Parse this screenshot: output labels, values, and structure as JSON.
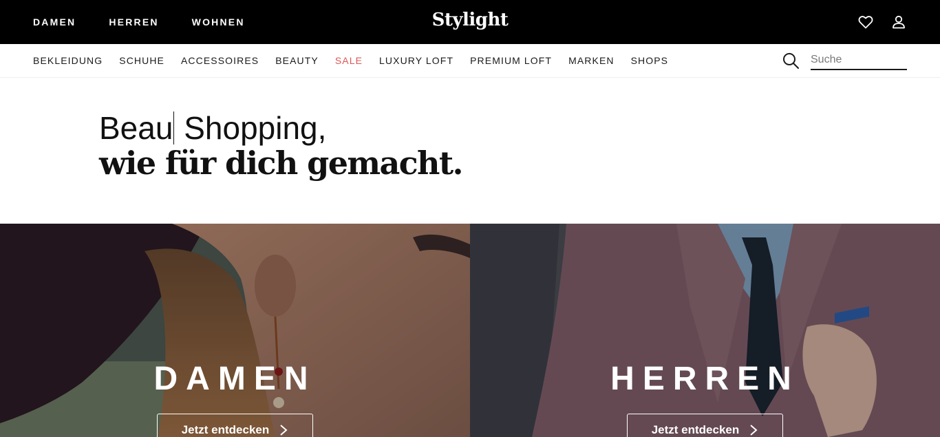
{
  "topbar": {
    "nav": [
      "DAMEN",
      "HERREN",
      "WOHNEN"
    ],
    "logo": "Stylight",
    "icons": [
      "heart-icon",
      "user-icon"
    ],
    "background": "#000000"
  },
  "categories": {
    "items": [
      "BEKLEIDUNG",
      "SCHUHE",
      "ACCESSOIRES",
      "BEAUTY",
      "SALE",
      "LUXURY LOFT",
      "PREMIUM LOFT",
      "MARKEN",
      "SHOPS"
    ],
    "sale_color": "#e05555"
  },
  "search": {
    "placeholder": "Suche",
    "value": ""
  },
  "hero": {
    "line1_typed": "Beau",
    "line1_rest": " Shopping,",
    "line2": "wie für dich gemacht."
  },
  "panels": [
    {
      "title": "DAMEN",
      "cta": "Jetzt entdecken"
    },
    {
      "title": "HERREN",
      "cta": "Jetzt entdecken"
    }
  ]
}
